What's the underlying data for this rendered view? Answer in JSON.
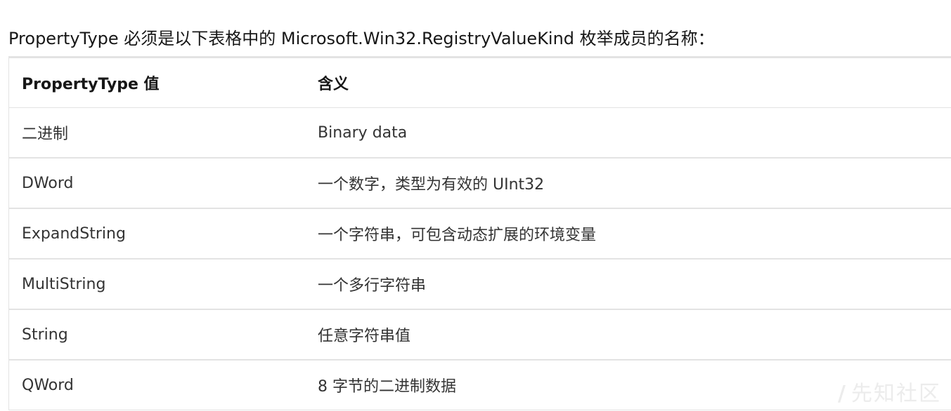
{
  "intro": "PropertyType 必须是以下表格中的 Microsoft.Win32.RegistryValueKind 枚举成员的名称：",
  "table": {
    "headers": [
      "PropertyType 值",
      "含义"
    ],
    "rows": [
      [
        "二进制",
        "Binary data"
      ],
      [
        "DWord",
        "一个数字，类型为有效的 UInt32"
      ],
      [
        "ExpandString",
        "一个字符串，可包含动态扩展的环境变量"
      ],
      [
        "MultiString",
        "一个多行字符串"
      ],
      [
        "String",
        "任意字符串值"
      ],
      [
        "QWord",
        "8 字节的二进制数据"
      ]
    ]
  },
  "watermark": {
    "mark": "/",
    "text": "先知社区"
  }
}
